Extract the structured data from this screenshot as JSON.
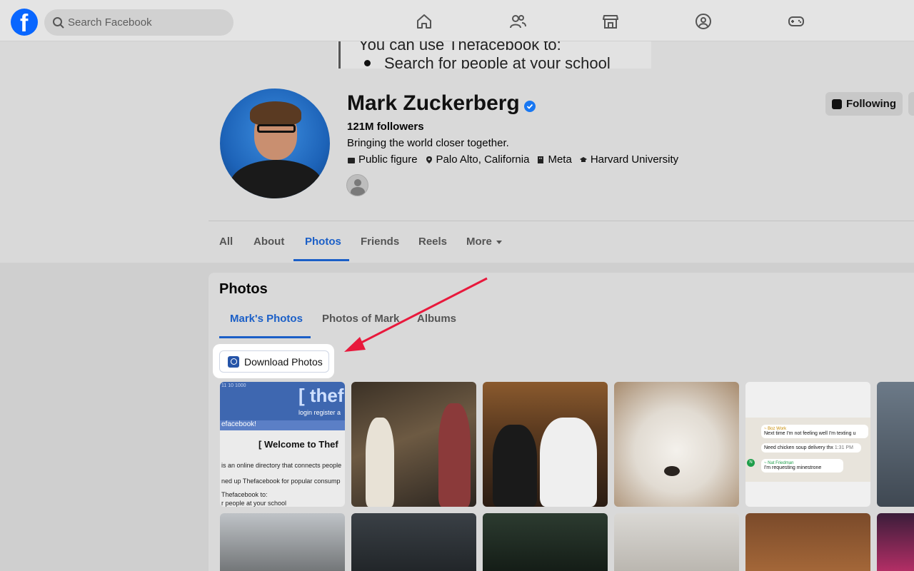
{
  "topbar": {
    "search_placeholder": "Search Facebook",
    "logo_letter": "f",
    "nav_icons": [
      "home-icon",
      "friends-icon",
      "marketplace-icon",
      "groups-icon",
      "gaming-icon"
    ]
  },
  "cover": {
    "line1": "You can use Thefacebook to:",
    "line2": "Search for people at your school"
  },
  "profile": {
    "name": "Mark Zuckerberg",
    "followers": "121M followers",
    "bio": "Bringing the world closer together.",
    "meta": {
      "category": "Public figure",
      "location": "Palo Alto, California",
      "work": "Meta",
      "education": "Harvard University"
    },
    "following_label": "Following"
  },
  "tabs": [
    "All",
    "About",
    "Photos",
    "Friends",
    "Reels",
    "More"
  ],
  "active_tab": "Photos",
  "photos_section": {
    "title": "Photos",
    "subtabs": [
      "Mark's Photos",
      "Photos of Mark",
      "Albums"
    ],
    "active_subtab": "Mark's Photos",
    "download_label": "Download Photos"
  },
  "thumb1": {
    "nums": "11  10  1000",
    "brand": "[ thef",
    "nav": "login  register  a",
    "bar": "efacebook!",
    "welcome": "[ Welcome to Thef",
    "line1": "is an online directory that connects people",
    "line2": "ned up Thefacebook for popular consump",
    "line3": "Thefacebook to:",
    "line4": "r people at your school"
  },
  "chat_thumb": {
    "sender1": "~ Boz Work",
    "msg1": "Next time I'm not feeling well I'm texting u",
    "msg2": "Need chicken soup delivery thx",
    "time": "1:31 PM",
    "sender2": "~ Nat Friedman",
    "msg3": "I'm requesting minestrone",
    "avatar_letter": "N"
  },
  "colors": {
    "accent": "#1b5fc7",
    "brand": "#0866ff",
    "annotation_arrow": "#e8193c"
  }
}
